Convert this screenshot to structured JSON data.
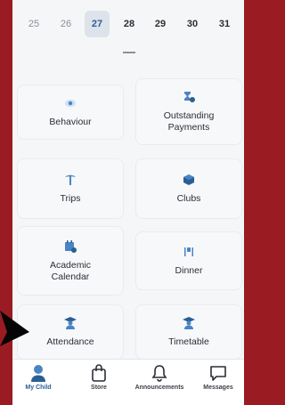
{
  "dates": [
    "25",
    "26",
    "27",
    "28",
    "29",
    "30",
    "31"
  ],
  "selected_date": "27",
  "cards": [
    {
      "label": "Behaviour",
      "icon": "eye-icon"
    },
    {
      "label": "Outstanding\nPayments",
      "icon": "hourglass-icon"
    },
    {
      "label": "Trips",
      "icon": "palm-tree-icon"
    },
    {
      "label": "Clubs",
      "icon": "cube-icon"
    },
    {
      "label": "Academic\nCalendar",
      "icon": "calendar-icon"
    },
    {
      "label": "Dinner",
      "icon": "cutlery-icon"
    },
    {
      "label": "Attendance",
      "icon": "student-icon"
    },
    {
      "label": "Timetable",
      "icon": "student-icon"
    }
  ],
  "nav": [
    {
      "label": "My Child",
      "icon": "user-icon",
      "active": true
    },
    {
      "label": "Store",
      "icon": "shopping-bag-icon",
      "active": false
    },
    {
      "label": "Announcements",
      "icon": "bell-icon",
      "active": false
    },
    {
      "label": "Messages",
      "icon": "message-icon",
      "active": false
    }
  ],
  "colors": {
    "accent": "#2a5f95",
    "icon_blue": "#4a84c4",
    "border_red": "#9a1b22"
  }
}
